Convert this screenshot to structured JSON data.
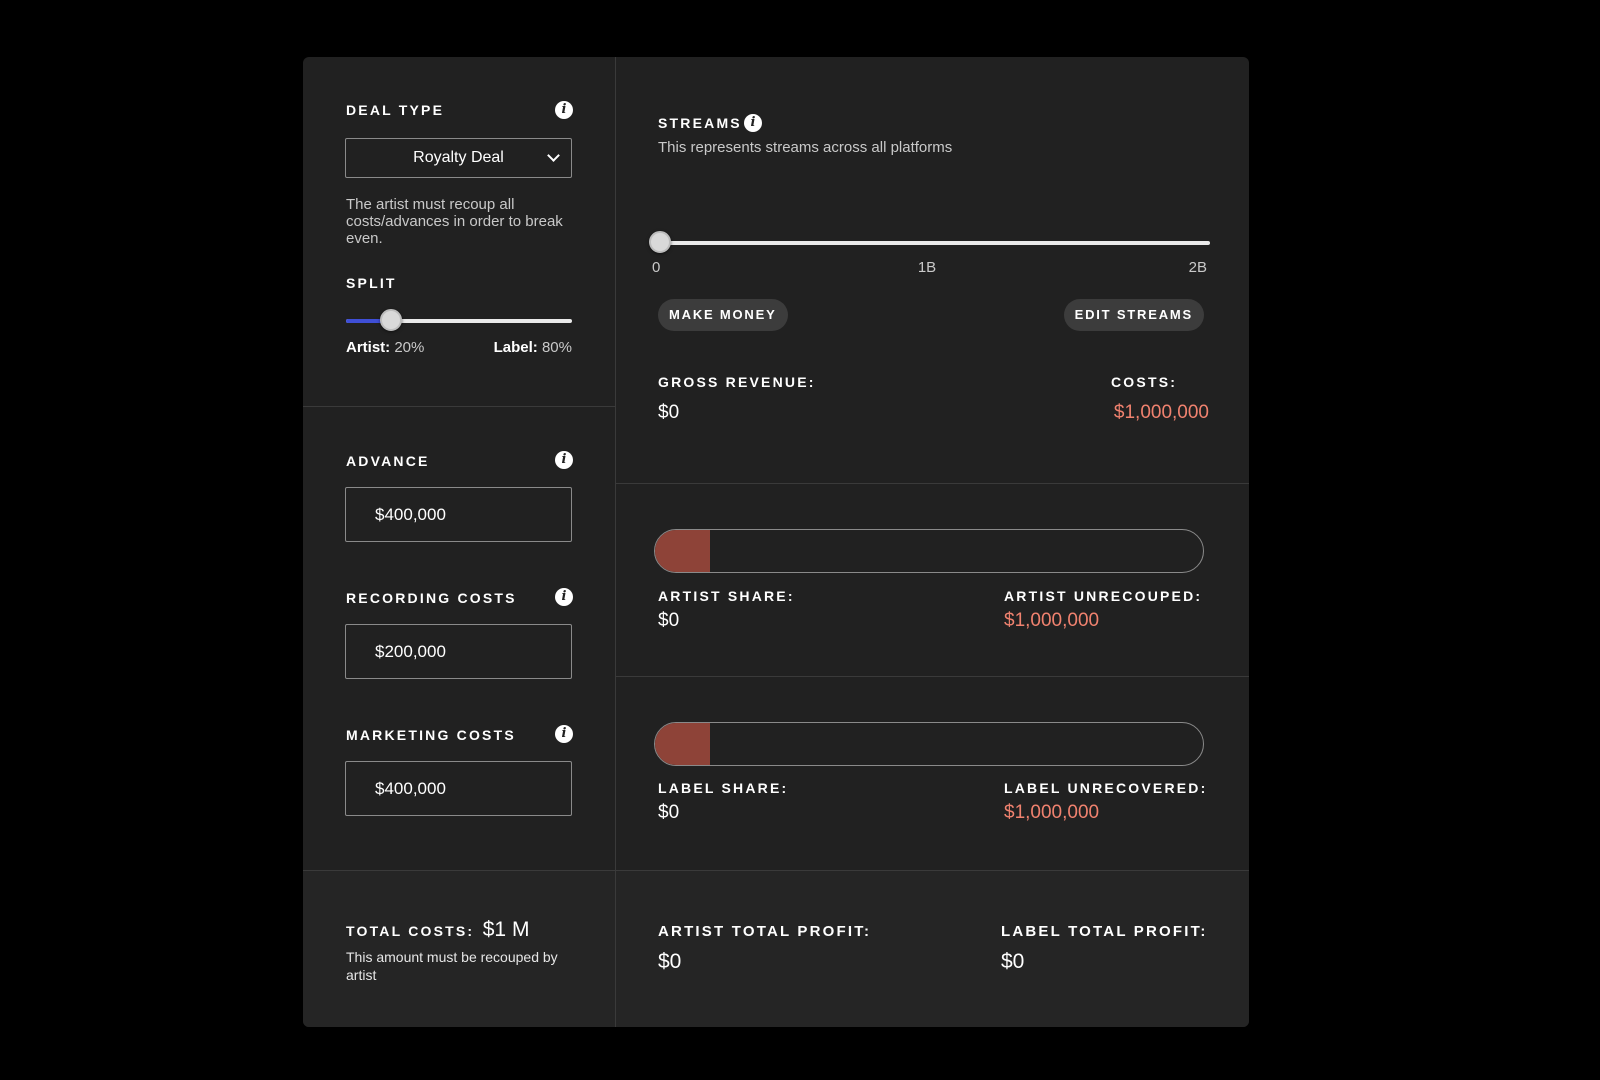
{
  "deal": {
    "label": "DEAL TYPE",
    "selected": "Royalty Deal",
    "description": "The artist must recoup all costs/advances in order to break even."
  },
  "split": {
    "label": "SPLIT",
    "artist_label": "Artist:",
    "artist_value": "20%",
    "label_label": "Label:",
    "label_value": "80%",
    "artist_fraction": 0.2
  },
  "inputs": {
    "advance": {
      "label": "ADVANCE",
      "value": "$400,000"
    },
    "recording": {
      "label": "RECORDING COSTS",
      "value": "$200,000"
    },
    "marketing": {
      "label": "MARKETING COSTS",
      "value": "$400,000"
    }
  },
  "totals": {
    "label": "TOTAL COSTS:",
    "value": "$1 M",
    "note": "This amount must be recouped by artist"
  },
  "streams": {
    "label": "STREAMS",
    "subtitle": "This represents streams across all platforms",
    "ticks": [
      "0",
      "1B",
      "2B"
    ],
    "value_fraction": 0
  },
  "buttons": {
    "make_money": "MAKE MONEY",
    "edit_streams": "EDIT STREAMS"
  },
  "revenue": {
    "gross_label": "GROSS REVENUE:",
    "gross_value": "$0",
    "costs_label": "COSTS:",
    "costs_value": "$1,000,000"
  },
  "artist": {
    "share_label": "ARTIST SHARE:",
    "share_value": "$0",
    "unrecouped_label": "ARTIST UNRECOUPED:",
    "unrecouped_value": "$1,000,000",
    "bar_fraction": 0.1
  },
  "label_stats": {
    "share_label": "LABEL SHARE:",
    "share_value": "$0",
    "unrecovered_label": "LABEL UNRECOVERED:",
    "unrecovered_value": "$1,000,000",
    "bar_fraction": 0.1
  },
  "profit": {
    "artist_label": "ARTIST TOTAL PROFIT:",
    "artist_value": "$0",
    "label_label": "LABEL TOTAL PROFIT:",
    "label_value": "$0"
  },
  "colors": {
    "accent_blue": "#3f4fd6",
    "negative": "#f0826f",
    "bar_fill": "#8e4338"
  }
}
